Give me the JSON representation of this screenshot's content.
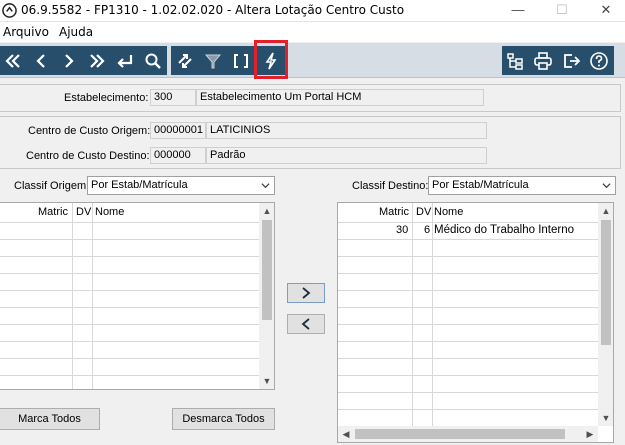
{
  "window": {
    "title": "06.9.5582 - FP1310 - 1.02.02.020 - Altera Lotação Centro Custo",
    "controls": {
      "minimize": "—",
      "maximize": "☐",
      "close": "✕"
    }
  },
  "menu": {
    "items": [
      "Arquivo",
      "Ajuda"
    ]
  },
  "toolbar": {
    "left_icons": [
      "first-icon",
      "previous-icon",
      "next-icon",
      "last-icon",
      "enter-icon",
      "search-icon"
    ],
    "mid_icons": [
      "refresh-icon",
      "filter-icon",
      "brackets-icon",
      "lightning-icon"
    ],
    "right_icons": [
      "tree-icon",
      "print-icon",
      "exit-icon",
      "help-icon"
    ],
    "highlight_color": "#e0202a"
  },
  "establishment": {
    "label": "Estabelecimento:",
    "code": "300",
    "name": "Estabelecimento Um Portal HCM"
  },
  "cost_center": {
    "origin_label": "Centro de Custo Origem:",
    "origin_code": "00000001",
    "origin_name": "LATICINIOS",
    "dest_label": "Centro de Custo Destino:",
    "dest_code": "000000",
    "dest_name": "Padrão"
  },
  "classif": {
    "origin_label": "Classif Origem:",
    "origin_value": "Por Estab/Matrícula",
    "dest_label": "Classif Destino:",
    "dest_value": "Por Estab/Matrícula"
  },
  "grid_columns": {
    "matric": "Matric",
    "dv": "DV",
    "nome": "Nome"
  },
  "origin_rows": [],
  "dest_rows": [
    {
      "matric": "30",
      "dv": "6",
      "nome": "Médico do Trabalho Interno"
    }
  ],
  "buttons": {
    "mark_all": "Marca Todos",
    "unmark_all": "Desmarca Todos"
  }
}
